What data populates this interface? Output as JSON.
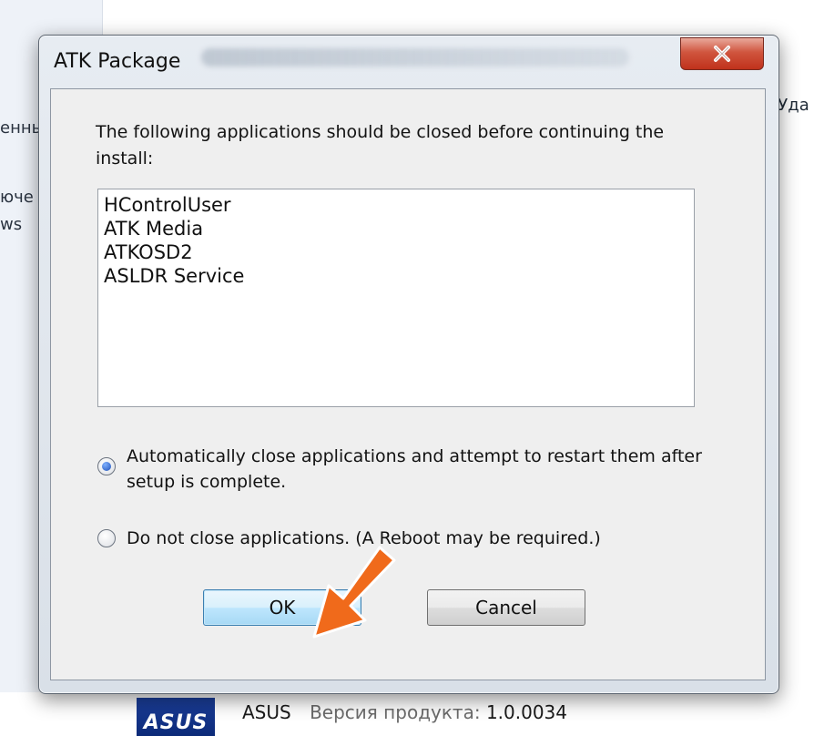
{
  "background": {
    "left_fragments": [
      "енны",
      "юче",
      "ws"
    ],
    "right_fragment": "\"Уда",
    "product": {
      "logo_text": "ASUS",
      "brand": "ASUS",
      "version_label": "Версия продукта:",
      "version_value": "1.0.0034"
    }
  },
  "dialog": {
    "title": "ATK Package",
    "intro": "The following applications should be closed before continuing the install:",
    "applications": [
      "HControlUser",
      "ATK Media",
      "ATKOSD2",
      "ASLDR Service"
    ],
    "options": [
      {
        "label": "Automatically close applications and attempt to restart them after setup is complete.",
        "selected": true
      },
      {
        "label": "Do not close applications. (A Reboot may be required.)",
        "selected": false
      }
    ],
    "ok_label": "OK",
    "cancel_label": "Cancel",
    "close_icon": "close-icon"
  },
  "colors": {
    "annotation_arrow": "#f06a1b",
    "close_button": "#c7432b",
    "default_button_border": "#3c7fb1"
  }
}
